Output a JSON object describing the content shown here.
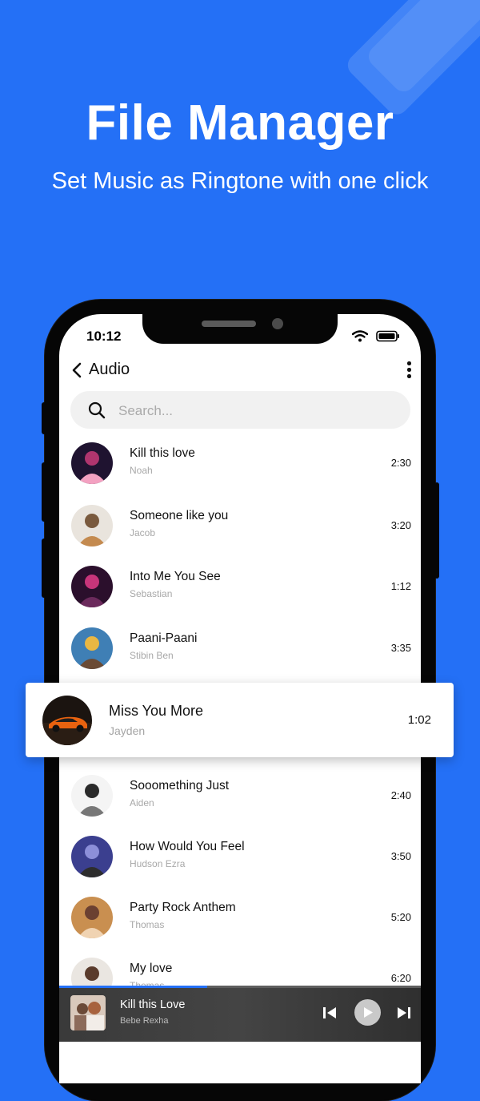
{
  "promo": {
    "title": "File Manager",
    "subtitle": "Set Music as Ringtone with one click"
  },
  "status_bar": {
    "time": "10:12",
    "icons": [
      "wifi-icon",
      "battery-icon"
    ]
  },
  "header": {
    "title": "Audio",
    "back_icon": "chevron-left-icon",
    "menu_icon": "more-vertical-icon"
  },
  "search": {
    "placeholder": "Search...",
    "icon": "search-icon"
  },
  "songs": [
    {
      "title": "Kill this love",
      "artist": "Noah",
      "duration": "2:30"
    },
    {
      "title": "Someone like you",
      "artist": "Jacob",
      "duration": "3:20"
    },
    {
      "title": "Into Me You See",
      "artist": "Sebastian",
      "duration": "1:12"
    },
    {
      "title": "Paani-Paani",
      "artist": "Stibin Ben",
      "duration": "3:35"
    },
    {
      "title": "Miss You More",
      "artist": "Jayden",
      "duration": "1:02"
    },
    {
      "title": "Sooomething Just",
      "artist": "Aiden",
      "duration": "2:40"
    },
    {
      "title": "How Would You Feel",
      "artist": "Hudson Ezra",
      "duration": "3:50"
    },
    {
      "title": "Party Rock Anthem",
      "artist": "Thomas",
      "duration": "5:20"
    },
    {
      "title": "My love",
      "artist": "Thomas",
      "duration": "6:20"
    }
  ],
  "highlighted_index": 4,
  "now_playing": {
    "title": "Kill this Love",
    "artist": "Bebe Rexha",
    "progress": 0.41,
    "controls": [
      "previous-icon",
      "play-icon",
      "next-icon"
    ]
  },
  "colors": {
    "background": "#2470f6",
    "accent": "#2470f6",
    "player_bg": "#3a3a3a"
  }
}
